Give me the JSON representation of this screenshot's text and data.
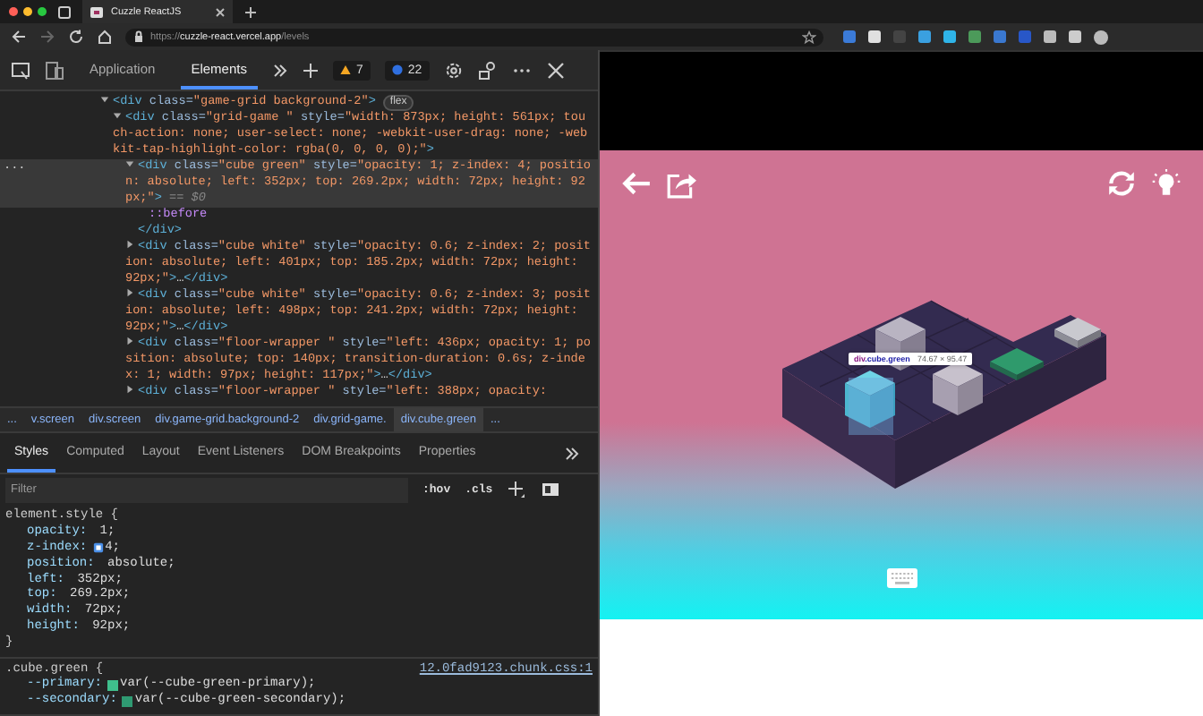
{
  "browser": {
    "tab_title": "Cuzzle ReactJS",
    "url": {
      "scheme": "https://",
      "host": "cuzzle-react.vercel.app",
      "path": "/levels"
    }
  },
  "devtools": {
    "tabs": [
      {
        "label": "Application",
        "selected": false
      },
      {
        "label": "Elements",
        "selected": true
      }
    ],
    "warnings": "7",
    "errors": "22",
    "dom_tree": [
      {
        "kind": "element",
        "expanded": true,
        "selected": false,
        "tokens": [
          {
            "kind": "tag",
            "text": "<div"
          },
          {
            "kind": "attr",
            "text": " class"
          },
          {
            "kind": "attr",
            "text": "="
          },
          {
            "kind": "value",
            "text": "\"game-grid background-2\""
          },
          {
            "kind": "tag",
            "text": ">"
          }
        ],
        "badge": "flex",
        "children": [
          {
            "kind": "element",
            "expanded": true,
            "selected": false,
            "tokens": [
              {
                "kind": "tag",
                "text": "<div"
              },
              {
                "kind": "attr",
                "text": " class"
              },
              {
                "kind": "attr",
                "text": "="
              },
              {
                "kind": "value",
                "text": "\"grid-game \""
              },
              {
                "kind": "attr",
                "text": " style"
              },
              {
                "kind": "attr",
                "text": "="
              },
              {
                "kind": "value",
                "text": "\"width: 873px; height: 561px; touch-action: none; user-select: none; -webkit-user-drag: none; -webkit-tap-highlight-color: rgba(0, 0, 0, 0);\""
              },
              {
                "kind": "tag",
                "text": ">"
              }
            ],
            "children": [
              {
                "kind": "element",
                "expanded": true,
                "selected": true,
                "gutter": "...",
                "tokens": [
                  {
                    "kind": "tag",
                    "text": "<div"
                  },
                  {
                    "kind": "attr",
                    "text": " class"
                  },
                  {
                    "kind": "attr",
                    "text": "="
                  },
                  {
                    "kind": "value",
                    "text": "\"cube  green\""
                  },
                  {
                    "kind": "attr",
                    "text": " style"
                  },
                  {
                    "kind": "attr",
                    "text": "="
                  },
                  {
                    "kind": "value",
                    "text": "\"opacity: 1; z-index: 4; position: absolute; left: 352px; top: 269.2px; width: 72px; height: 92px;\""
                  },
                  {
                    "kind": "tag",
                    "text": ">"
                  },
                  {
                    "kind": "hint",
                    "text": " == $0"
                  }
                ],
                "children": [
                  {
                    "kind": "pseudo",
                    "tokens": [
                      {
                        "kind": "pseudo",
                        "text": "::before"
                      }
                    ]
                  }
                ],
                "closing": "</div>"
              },
              {
                "kind": "element",
                "expanded": false,
                "selected": false,
                "tokens": [
                  {
                    "kind": "tag",
                    "text": "<div"
                  },
                  {
                    "kind": "attr",
                    "text": " class"
                  },
                  {
                    "kind": "attr",
                    "text": "="
                  },
                  {
                    "kind": "value",
                    "text": "\"cube  white\""
                  },
                  {
                    "kind": "attr",
                    "text": " style"
                  },
                  {
                    "kind": "attr",
                    "text": "="
                  },
                  {
                    "kind": "value",
                    "text": "\"opacity: 0.6; z-index: 2; position: absolute; left: 401px; top: 185.2px; width: 72px; height: 92px;\""
                  },
                  {
                    "kind": "tag",
                    "text": ">"
                  },
                  {
                    "kind": "text",
                    "text": "…"
                  },
                  {
                    "kind": "tag",
                    "text": "</div>"
                  }
                ]
              },
              {
                "kind": "element",
                "expanded": false,
                "selected": false,
                "tokens": [
                  {
                    "kind": "tag",
                    "text": "<div"
                  },
                  {
                    "kind": "attr",
                    "text": " class"
                  },
                  {
                    "kind": "attr",
                    "text": "="
                  },
                  {
                    "kind": "value",
                    "text": "\"cube  white\""
                  },
                  {
                    "kind": "attr",
                    "text": " style"
                  },
                  {
                    "kind": "attr",
                    "text": "="
                  },
                  {
                    "kind": "value",
                    "text": "\"opacity: 0.6; z-index: 3; position: absolute; left: 498px; top: 241.2px; width: 72px; height: 92px;\""
                  },
                  {
                    "kind": "tag",
                    "text": ">"
                  },
                  {
                    "kind": "text",
                    "text": "…"
                  },
                  {
                    "kind": "tag",
                    "text": "</div>"
                  }
                ]
              },
              {
                "kind": "element",
                "expanded": false,
                "selected": false,
                "tokens": [
                  {
                    "kind": "tag",
                    "text": "<div"
                  },
                  {
                    "kind": "attr",
                    "text": " class"
                  },
                  {
                    "kind": "attr",
                    "text": "="
                  },
                  {
                    "kind": "value",
                    "text": "\"floor-wrapper  \""
                  },
                  {
                    "kind": "attr",
                    "text": " style"
                  },
                  {
                    "kind": "attr",
                    "text": "="
                  },
                  {
                    "kind": "value",
                    "text": "\"left: 436px; opacity: 1; position: absolute; top: 140px; transition-duration: 0.6s; z-index: 1; width: 97px; height: 117px;\""
                  },
                  {
                    "kind": "tag",
                    "text": ">"
                  },
                  {
                    "kind": "text",
                    "text": "…"
                  },
                  {
                    "kind": "tag",
                    "text": "</div>"
                  }
                ]
              },
              {
                "kind": "element",
                "expanded": false,
                "selected": false,
                "tokens": [
                  {
                    "kind": "tag",
                    "text": "<div"
                  },
                  {
                    "kind": "attr",
                    "text": " class"
                  },
                  {
                    "kind": "attr",
                    "text": "="
                  },
                  {
                    "kind": "value",
                    "text": "\"floor-wrapper  \""
                  },
                  {
                    "kind": "attr",
                    "text": " style"
                  },
                  {
                    "kind": "attr",
                    "text": "="
                  },
                  {
                    "kind": "value",
                    "text": "\"left: 388px; opacity:"
                  }
                ]
              }
            ]
          }
        ]
      }
    ],
    "breadcrumbs": [
      {
        "label": "...",
        "selected": false
      },
      {
        "label": "v.screen",
        "selected": false
      },
      {
        "label": "div.screen",
        "selected": false
      },
      {
        "label": "div.game-grid.background-2",
        "selected": false
      },
      {
        "label": "div.grid-game.",
        "selected": false
      },
      {
        "label": "div.cube.green",
        "selected": true
      },
      {
        "label": "...",
        "selected": false
      }
    ],
    "style_tabs": [
      {
        "label": "Styles",
        "selected": true
      },
      {
        "label": "Computed",
        "selected": false
      },
      {
        "label": "Layout",
        "selected": false
      },
      {
        "label": "Event Listeners",
        "selected": false
      },
      {
        "label": "DOM Breakpoints",
        "selected": false
      },
      {
        "label": "Properties",
        "selected": false
      }
    ],
    "filter_placeholder": "Filter",
    "toggles": [
      ":hov",
      ".cls"
    ],
    "rules": [
      {
        "selector": "element.style {",
        "close": "}",
        "props": [
          {
            "kind": "plain",
            "name": "opacity:",
            "value": " 1;"
          },
          {
            "kind": "stacking",
            "name": "z-index:",
            "value": "4;"
          },
          {
            "kind": "plain",
            "name": "position:",
            "value": " absolute;"
          },
          {
            "kind": "plain",
            "name": "left:",
            "value": " 352px;"
          },
          {
            "kind": "plain",
            "name": "top:",
            "value": " 269.2px;"
          },
          {
            "kind": "plain",
            "name": "width:",
            "value": " 72px;"
          },
          {
            "kind": "plain",
            "name": "height:",
            "value": " 92px;"
          }
        ]
      },
      {
        "selector": ".cube.green {",
        "source": "12.0fad9123.chunk.css:1",
        "props": [
          {
            "kind": "color",
            "name": "--primary:",
            "value": "var(--cube-green-primary);",
            "color": "#3fbf8c"
          },
          {
            "kind": "color",
            "name": "--secondary:",
            "value": "var(--cube-green-secondary);",
            "color": "#2f9a72"
          }
        ]
      }
    ]
  },
  "page": {
    "tooltip": {
      "tag": "div",
      "classes": ".cube.green",
      "size": "74.67 × 95.47"
    }
  }
}
